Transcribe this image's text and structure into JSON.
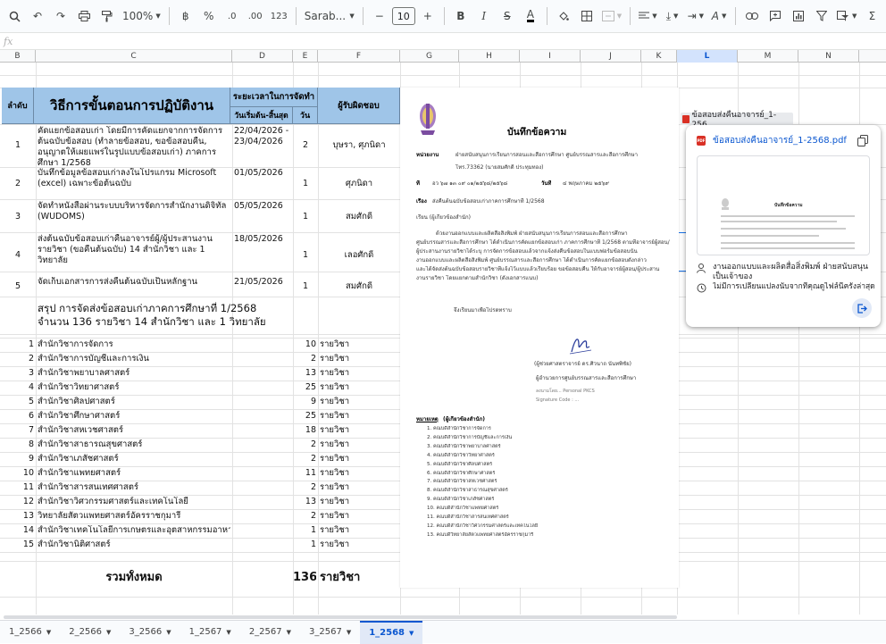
{
  "toolbar": {
    "zoom": "100%",
    "currency": "฿",
    "percent": "%",
    "dec_decrease": ".0",
    "dec_increase": ".00",
    "number_format": "123",
    "font": "Sarab...",
    "font_size": "10",
    "minus": "−",
    "plus": "+",
    "bold": "B",
    "italic": "I",
    "sigma": "Σ"
  },
  "formula_bar": {
    "fx": "fx",
    "value": ""
  },
  "columns": [
    "B",
    "C",
    "D",
    "E",
    "F",
    "G",
    "H",
    "I",
    "J",
    "K",
    "L",
    "M",
    "N"
  ],
  "table_header": {
    "col_order": "ลำดับ",
    "col_procedure": "วิธีการขั้นตอนการปฏิบัติงาน",
    "col_duration": "ระยะเวลาในการจัดทำ",
    "col_dates": "วันเริ่มต้น-สิ้นสุด",
    "col_days": "วัน",
    "col_owner": "ผู้รับผิดชอบ"
  },
  "steps": [
    {
      "no": "1",
      "text": "คัดแยกข้อสอบเก่า โดยมีการคัดแยกจากการจัดการต้นฉบับข้อสอบ (ทำลายข้อสอบ, ขอข้อสอบคืน, อนุญาตให้เผยแพร่ในรูปแบบข้อสอบเก่า) ภาคการศึกษา 1/2568",
      "dates": "22/04/2026 - 23/04/2026",
      "days": "2",
      "owner": "บุษรา, ศุภนิดา"
    },
    {
      "no": "2",
      "text": "บันทึกข้อมูลข้อสอบเก่าลงในโปรแกรม Microsoft (excel) เฉพาะข้อต้นฉบับ",
      "dates": "01/05/2026",
      "days": "1",
      "owner": "ศุภนิดา"
    },
    {
      "no": "3",
      "text": "จัดทำหนังสือผ่านระบบบริหารจัดการสำนักงานดิจิทัล (WUDOMS)",
      "dates": "05/05/2026",
      "days": "1",
      "owner": "สมศักดิ์"
    },
    {
      "no": "4",
      "text": "ส่งต้นฉบับข้อสอบเก่าคืนอาจารย์ผู้/ผู้ประสานงานรายวิชา (ขอคืนต้นฉบับ) 14 สำนักวิชา และ 1 วิทยาลัย",
      "dates": "18/05/2026",
      "days": "1",
      "owner": "เลอศักดิ์"
    },
    {
      "no": "5",
      "text": "จัดเก็บเอกสารการส่งคืนต้นฉบับเป็นหลักฐาน",
      "dates": "21/05/2026",
      "days": "1",
      "owner": "สมศักดิ์"
    }
  ],
  "summary": {
    "line1": "สรุป การจัดส่งข้อสอบเก่าภาคการศึกษาที่ 1/2568",
    "line2": "จำนวน 136 รายวิชา  14 สำนักวิชา และ 1 วิทยาลัย"
  },
  "unit_word": "รายวิชา",
  "schools": [
    {
      "no": "1",
      "name": "สำนักวิชาการจัดการ",
      "count": "10"
    },
    {
      "no": "2",
      "name": "สำนักวิชาการบัญชีและการเงิน",
      "count": "2"
    },
    {
      "no": "3",
      "name": "สำนักวิชาพยาบาลศาสตร์",
      "count": "13"
    },
    {
      "no": "4",
      "name": "สำนักวิชาวิทยาศาสตร์",
      "count": "25"
    },
    {
      "no": "5",
      "name": "สำนักวิชาศิลปศาสตร์",
      "count": "9"
    },
    {
      "no": "6",
      "name": "สำนักวิชาศึกษาศาสตร์",
      "count": "25"
    },
    {
      "no": "7",
      "name": "สำนักวิชาสหเวชศาสตร์",
      "count": "18"
    },
    {
      "no": "8",
      "name": "สำนักวิชาสาธารณสุขศาสตร์",
      "count": "2"
    },
    {
      "no": "9",
      "name": "สำนักวิชาเภสัชศาสตร์",
      "count": "2"
    },
    {
      "no": "10",
      "name": "สำนักวิชาแพทยศาสตร์",
      "count": "11"
    },
    {
      "no": "11",
      "name": "สำนักวิชาสารสนเทศศาสตร์",
      "count": "2"
    },
    {
      "no": "12",
      "name": "สำนักวิชาวิศวกรรมศาสตร์และเทคโนโลยี",
      "count": "13"
    },
    {
      "no": "13",
      "name": "วิทยาลัยสัตวแพทยศาสตร์อัครราชกุมารี",
      "count": "2"
    },
    {
      "no": "14",
      "name": "สำนักวิชาเทคโนโลยีการเกษตรและอุตสาหกรรมอาหาร",
      "count": "1"
    },
    {
      "no": "15",
      "name": "สำนักวิชานิติศาสตร์",
      "count": "1"
    }
  ],
  "total": {
    "label": "รวมทั้งหมด",
    "value": "136",
    "unit": "รายวิชา"
  },
  "memo": {
    "title": "บันทึกข้อความ",
    "agency_label": "หน่วยงาน",
    "agency": "ฝ่ายสนับสนุนการเรียนการสอนและสื่อการศึกษา ศูนย์บรรณสารและสื่อการศึกษา",
    "agency2": "โทร.73362 (นายสมศักดิ์ ประทุมทอง)",
    "no_label": "ที่",
    "no_value": "อว ๖๗ ๑๓ ๐๙ ๐๑/๒๕๖๘/๒๕๖๘",
    "date_label": "วันที่",
    "date_value": "๔ พฤษภาคม ๒๕๖๙",
    "subject_label": "เรื่อง",
    "subject": "ส่งคืนต้นฉบับข้อสอบเก่าภาคการศึกษาที่ 1/2568",
    "to": "เรียน  (ผู้เกี่ยวข้องสำนัก)",
    "body1": "ด้วยงานออกแบบและผลิตสื่อสิ่งพิมพ์ ฝ่ายสนับสนุนการเรียนการสอนและสื่อการศึกษา",
    "body2": "ศูนย์บรรณสารและสื่อการศึกษา ได้ดำเนินการคัดแยกข้อสอบเก่า ภาคการศึกษาที่ 1/2568 ตามที่อาจารย์ผู้สอน/",
    "body3": "ผู้ประสานงานรายวิชาได้ระบุ การจัดการข้อสอบแล้วจากแจ้งส่งคืนข้อสอบในแบบฟอร์มข้อสอบนั้น",
    "body4": "งานออกแบบและผลิตสื่อสิ่งพิมพ์ ศูนย์บรรณสารและสื่อการศึกษา ได้ดำเนินการคัดแยกข้อสอบดังกล่าว",
    "body5": "และได้จัดส่งต้นฉบับข้อสอบรายวิชาที่แจ้งไว้แบบแล้วเรียบร้อย ขอข้อสอบคืน ให้กับอาจารย์ผู้สอน/ผู้ประสาน",
    "body6": "งานรายวิชา โดยแยกตามสำนักวิชา (ดังเอกสารแนบ)",
    "closing": "จึงเรียนมาเพื่อโปรดทราบ",
    "sign1": "(ผู้ช่วยศาสตราจารย์ ดร.ศิวนาถ นันทพิชัย)",
    "sign2": "ผู้อำนวยการศูนย์บรรณสารและสื่อการศึกษา",
    "sign3": "ลงนามโดย...  Personal PKCS",
    "sign4": "Signature Code : ...",
    "note_label": "หมายเหตุ",
    "note_title": "(ผู้เกี่ยวข้องสำนัก)",
    "notes": [
      "1. คณบดีสำนักวิชาการจัดการ",
      "2. คณบดีสำนักวิชาการบัญชีและการเงิน",
      "3. คณบดีสำนักวิชาพยาบาลศาสตร์",
      "4. คณบดีสำนักวิชาวิทยาศาสตร์",
      "5. คณบดีสำนักวิชาศิลปศาสตร์",
      "6. คณบดีสำนักวิชาศึกษาศาสตร์",
      "7. คณบดีสำนักวิชาสหเวชศาสตร์",
      "8. คณบดีสำนักวิชาสาธารณสุขศาสตร์",
      "9. คณบดีสำนักวิชาเภสัชศาสตร์",
      "10. คณบดีสำนักวิชาแพทยศาสตร์",
      "11. คณบดีสำนักวิชาสารสนเทศศาสตร์",
      "12. คณบดีสำนักวิชาวิศวกรรมศาสตร์และเทคโนโลยี",
      "13. คณบดีวิทยาลัยสัตวแพทยศาสตร์อัครราชกุมารี"
    ]
  },
  "chip_label": "ข้อสอบส่งคืนอาจารย์_1-256...",
  "popup": {
    "file_name": "ข้อสอบส่งคืนอาจารย์_1-2568.pdf",
    "owner": "งานออกแบบและผลิตสื่อสิ่งพิมพ์ ฝ่ายสนับสนุน เป็นเจ้าของ",
    "history": "ไม่มีการเปลี่ยนแปลงนับจากที่คุณดูไฟล์นี้ครั้งล่าสุด",
    "thumb_title": "บันทึกข้อความ"
  },
  "sheets": [
    "1_2566",
    "2_2566",
    "3_2566",
    "1_2567",
    "2_2567",
    "3_2567",
    "1_2568"
  ],
  "active_sheet": "1_2568"
}
